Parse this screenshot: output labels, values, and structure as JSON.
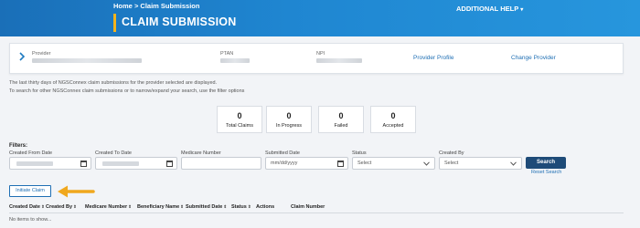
{
  "header": {
    "breadcrumb_home": "Home",
    "breadcrumb_sep": ">",
    "breadcrumb_current": "Claim Submission",
    "title": "CLAIM SUBMISSION",
    "help_label": "ADDITIONAL HELP",
    "help_caret": "▾",
    "accent_color": "#f5b31b",
    "bar_color": "#1f86d1"
  },
  "provider": {
    "provider_label": "Provider",
    "ptan_label": "PTAN",
    "npi_label": "NPI",
    "profile_link": "Provider Profile",
    "change_link": "Change Provider",
    "expand_icon": "chevron-right-icon"
  },
  "info": {
    "line1": "The last thirty days of NGSConnex claim submissions for the provider selected are displayed.",
    "line2": "To search for other NGSConnex claim submissions or to narrow/expand your search, use the filter options"
  },
  "counters": [
    {
      "value": "0",
      "label": "Total Claims"
    },
    {
      "value": "0",
      "label": "In Progress"
    },
    {
      "value": "0",
      "label": "Failed"
    },
    {
      "value": "0",
      "label": "Accepted"
    }
  ],
  "filters": {
    "title": "Filters:",
    "created_from_label": "Created From Date",
    "created_to_label": "Created To Date",
    "medicare_label": "Medicare Number",
    "submitted_label": "Submitted Date",
    "submitted_placeholder": "mm/dd/yyyy",
    "status_label": "Status",
    "status_value": "Select",
    "created_by_label": "Created By",
    "created_by_value": "Select",
    "search_button": "Search",
    "reset_link": "Reset Search"
  },
  "actions": {
    "initiate_claim": "Initiate Claim",
    "arrow_color": "#f0a81e"
  },
  "table": {
    "columns": [
      "Created Date",
      "Created By",
      "Medicare Number",
      "Beneficiary Name",
      "Submitted Date",
      "Status",
      "Actions",
      "Claim Number"
    ],
    "sort_glyph": "⇕",
    "empty_text": "No items to show..."
  }
}
